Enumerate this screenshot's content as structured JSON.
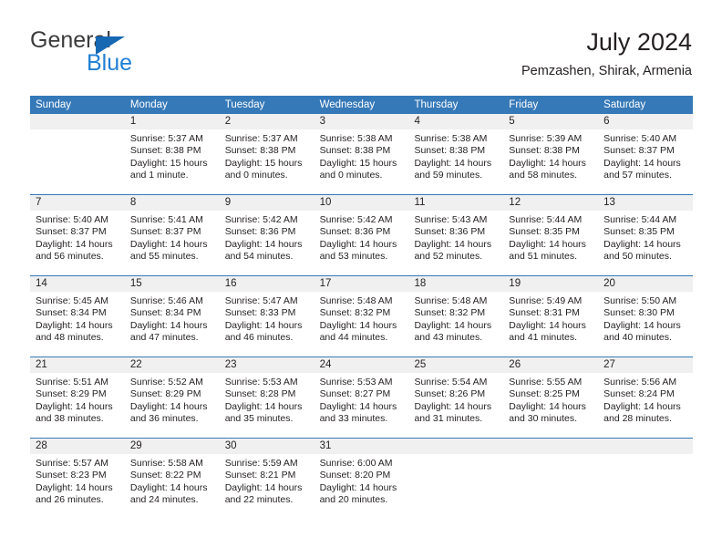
{
  "logo": {
    "word1": "General",
    "word2": "Blue",
    "triangle_color": "#1668b3",
    "word2_color": "#1f7fd4"
  },
  "header": {
    "title": "July 2024",
    "subtitle": "Pemzashen, Shirak, Armenia"
  },
  "theme": {
    "header_blue": "#3679b8",
    "day_number_bg": "#f0f0f0",
    "text": "#231f20"
  },
  "calendar": {
    "weekdays": [
      "Sunday",
      "Monday",
      "Tuesday",
      "Wednesday",
      "Thursday",
      "Friday",
      "Saturday"
    ],
    "weeks": [
      [
        {
          "day": "",
          "lines": []
        },
        {
          "day": "1",
          "lines": [
            "Sunrise: 5:37 AM",
            "Sunset: 8:38 PM",
            "Daylight: 15 hours and 1 minute."
          ]
        },
        {
          "day": "2",
          "lines": [
            "Sunrise: 5:37 AM",
            "Sunset: 8:38 PM",
            "Daylight: 15 hours and 0 minutes."
          ]
        },
        {
          "day": "3",
          "lines": [
            "Sunrise: 5:38 AM",
            "Sunset: 8:38 PM",
            "Daylight: 15 hours and 0 minutes."
          ]
        },
        {
          "day": "4",
          "lines": [
            "Sunrise: 5:38 AM",
            "Sunset: 8:38 PM",
            "Daylight: 14 hours and 59 minutes."
          ]
        },
        {
          "day": "5",
          "lines": [
            "Sunrise: 5:39 AM",
            "Sunset: 8:38 PM",
            "Daylight: 14 hours and 58 minutes."
          ]
        },
        {
          "day": "6",
          "lines": [
            "Sunrise: 5:40 AM",
            "Sunset: 8:37 PM",
            "Daylight: 14 hours and 57 minutes."
          ]
        }
      ],
      [
        {
          "day": "7",
          "lines": [
            "Sunrise: 5:40 AM",
            "Sunset: 8:37 PM",
            "Daylight: 14 hours and 56 minutes."
          ]
        },
        {
          "day": "8",
          "lines": [
            "Sunrise: 5:41 AM",
            "Sunset: 8:37 PM",
            "Daylight: 14 hours and 55 minutes."
          ]
        },
        {
          "day": "9",
          "lines": [
            "Sunrise: 5:42 AM",
            "Sunset: 8:36 PM",
            "Daylight: 14 hours and 54 minutes."
          ]
        },
        {
          "day": "10",
          "lines": [
            "Sunrise: 5:42 AM",
            "Sunset: 8:36 PM",
            "Daylight: 14 hours and 53 minutes."
          ]
        },
        {
          "day": "11",
          "lines": [
            "Sunrise: 5:43 AM",
            "Sunset: 8:36 PM",
            "Daylight: 14 hours and 52 minutes."
          ]
        },
        {
          "day": "12",
          "lines": [
            "Sunrise: 5:44 AM",
            "Sunset: 8:35 PM",
            "Daylight: 14 hours and 51 minutes."
          ]
        },
        {
          "day": "13",
          "lines": [
            "Sunrise: 5:44 AM",
            "Sunset: 8:35 PM",
            "Daylight: 14 hours and 50 minutes."
          ]
        }
      ],
      [
        {
          "day": "14",
          "lines": [
            "Sunrise: 5:45 AM",
            "Sunset: 8:34 PM",
            "Daylight: 14 hours and 48 minutes."
          ]
        },
        {
          "day": "15",
          "lines": [
            "Sunrise: 5:46 AM",
            "Sunset: 8:34 PM",
            "Daylight: 14 hours and 47 minutes."
          ]
        },
        {
          "day": "16",
          "lines": [
            "Sunrise: 5:47 AM",
            "Sunset: 8:33 PM",
            "Daylight: 14 hours and 46 minutes."
          ]
        },
        {
          "day": "17",
          "lines": [
            "Sunrise: 5:48 AM",
            "Sunset: 8:32 PM",
            "Daylight: 14 hours and 44 minutes."
          ]
        },
        {
          "day": "18",
          "lines": [
            "Sunrise: 5:48 AM",
            "Sunset: 8:32 PM",
            "Daylight: 14 hours and 43 minutes."
          ]
        },
        {
          "day": "19",
          "lines": [
            "Sunrise: 5:49 AM",
            "Sunset: 8:31 PM",
            "Daylight: 14 hours and 41 minutes."
          ]
        },
        {
          "day": "20",
          "lines": [
            "Sunrise: 5:50 AM",
            "Sunset: 8:30 PM",
            "Daylight: 14 hours and 40 minutes."
          ]
        }
      ],
      [
        {
          "day": "21",
          "lines": [
            "Sunrise: 5:51 AM",
            "Sunset: 8:29 PM",
            "Daylight: 14 hours and 38 minutes."
          ]
        },
        {
          "day": "22",
          "lines": [
            "Sunrise: 5:52 AM",
            "Sunset: 8:29 PM",
            "Daylight: 14 hours and 36 minutes."
          ]
        },
        {
          "day": "23",
          "lines": [
            "Sunrise: 5:53 AM",
            "Sunset: 8:28 PM",
            "Daylight: 14 hours and 35 minutes."
          ]
        },
        {
          "day": "24",
          "lines": [
            "Sunrise: 5:53 AM",
            "Sunset: 8:27 PM",
            "Daylight: 14 hours and 33 minutes."
          ]
        },
        {
          "day": "25",
          "lines": [
            "Sunrise: 5:54 AM",
            "Sunset: 8:26 PM",
            "Daylight: 14 hours and 31 minutes."
          ]
        },
        {
          "day": "26",
          "lines": [
            "Sunrise: 5:55 AM",
            "Sunset: 8:25 PM",
            "Daylight: 14 hours and 30 minutes."
          ]
        },
        {
          "day": "27",
          "lines": [
            "Sunrise: 5:56 AM",
            "Sunset: 8:24 PM",
            "Daylight: 14 hours and 28 minutes."
          ]
        }
      ],
      [
        {
          "day": "28",
          "lines": [
            "Sunrise: 5:57 AM",
            "Sunset: 8:23 PM",
            "Daylight: 14 hours and 26 minutes."
          ]
        },
        {
          "day": "29",
          "lines": [
            "Sunrise: 5:58 AM",
            "Sunset: 8:22 PM",
            "Daylight: 14 hours and 24 minutes."
          ]
        },
        {
          "day": "30",
          "lines": [
            "Sunrise: 5:59 AM",
            "Sunset: 8:21 PM",
            "Daylight: 14 hours and 22 minutes."
          ]
        },
        {
          "day": "31",
          "lines": [
            "Sunrise: 6:00 AM",
            "Sunset: 8:20 PM",
            "Daylight: 14 hours and 20 minutes."
          ]
        },
        {
          "day": "",
          "lines": []
        },
        {
          "day": "",
          "lines": []
        },
        {
          "day": "",
          "lines": []
        }
      ]
    ]
  }
}
